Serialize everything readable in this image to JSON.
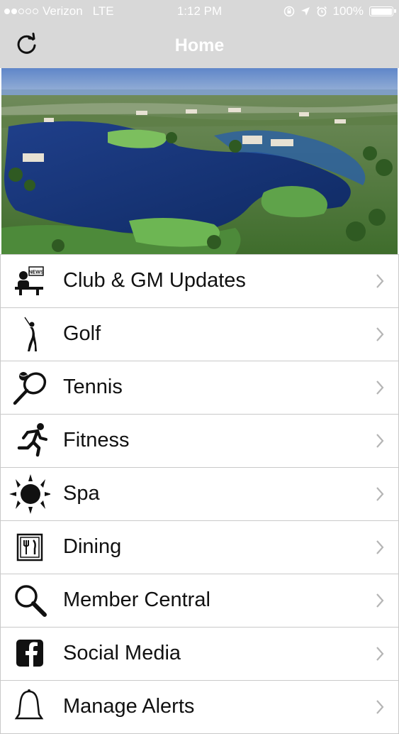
{
  "status_bar": {
    "signal_dots_filled": 2,
    "signal_dots_total": 5,
    "carrier": "Verizon",
    "network": "LTE",
    "time": "1:12 PM",
    "battery_percent": "100%",
    "icons": [
      "rotation-lock-icon",
      "location-arrow-icon",
      "alarm-icon",
      "battery-icon"
    ]
  },
  "nav": {
    "title": "Home",
    "refresh_icon": "refresh-icon"
  },
  "hero": {
    "description_icon": "golf-course-aerial-photo"
  },
  "menu": {
    "items": [
      {
        "label": "Club & GM Updates",
        "icon": "news-speaker-icon"
      },
      {
        "label": "Golf",
        "icon": "golfer-icon"
      },
      {
        "label": "Tennis",
        "icon": "tennis-racket-icon"
      },
      {
        "label": "Fitness",
        "icon": "runner-icon"
      },
      {
        "label": "Spa",
        "icon": "sun-icon"
      },
      {
        "label": "Dining",
        "icon": "dining-utensils-icon"
      },
      {
        "label": "Member Central",
        "icon": "magnifier-icon"
      },
      {
        "label": "Social Media",
        "icon": "facebook-icon"
      },
      {
        "label": "Manage Alerts",
        "icon": "bell-icon"
      }
    ],
    "chevron_icon": "chevron-right-icon"
  },
  "colors": {
    "topbar": "#d8d8d8",
    "divider": "#c9c9c9",
    "text": "#111111",
    "chevron": "#b5b5b5"
  }
}
